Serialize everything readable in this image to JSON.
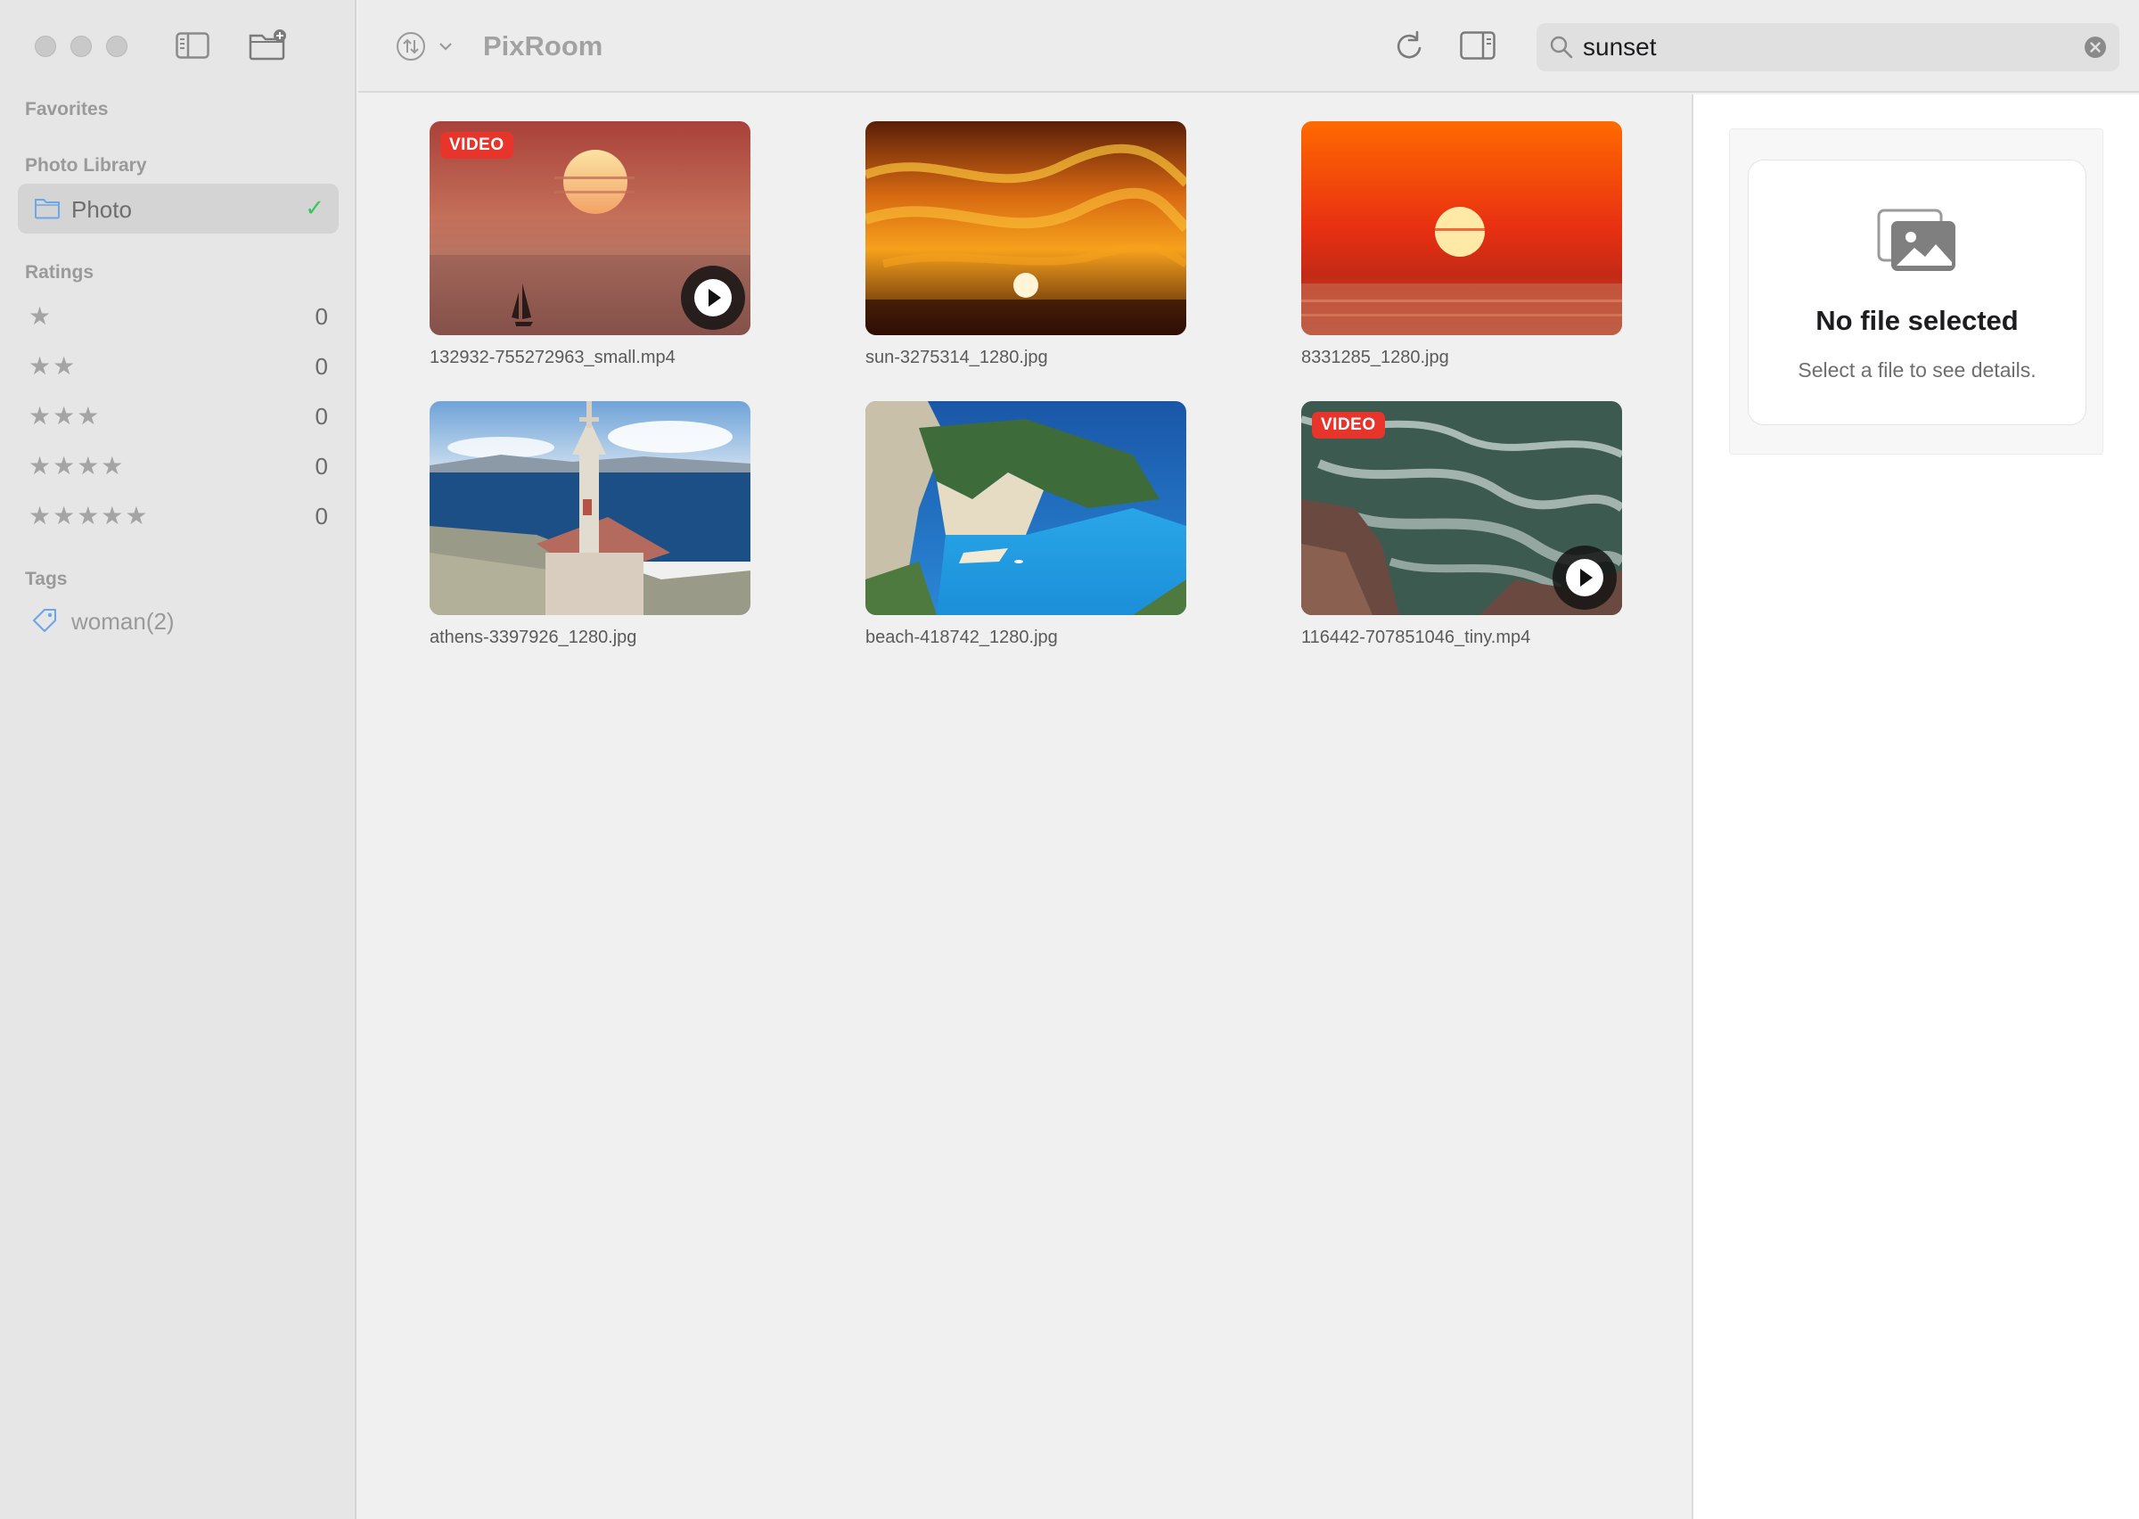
{
  "app": {
    "title": "PixRoom"
  },
  "search": {
    "value": "sunset"
  },
  "sidebar": {
    "favorites_label": "Favorites",
    "library_label": "Photo Library",
    "library_items": [
      {
        "label": "Photo",
        "selected": true
      }
    ],
    "ratings_label": "Ratings",
    "ratings": [
      {
        "stars": "★",
        "count": "0"
      },
      {
        "stars": "★★",
        "count": "0"
      },
      {
        "stars": "★★★",
        "count": "0"
      },
      {
        "stars": "★★★★",
        "count": "0"
      },
      {
        "stars": "★★★★★",
        "count": "0"
      }
    ],
    "tags_label": "Tags",
    "tags": [
      {
        "label": "woman(2)"
      }
    ]
  },
  "grid": {
    "items": [
      {
        "name": "132932-755272963_small.mp4",
        "is_video": true,
        "badge": "VIDEO",
        "scene": "sunset-sailboat"
      },
      {
        "name": "sun-3275314_1280.jpg",
        "is_video": false,
        "scene": "orange-sky-sunset"
      },
      {
        "name": "8331285_1280.jpg",
        "is_video": false,
        "scene": "red-sea-sunset"
      },
      {
        "name": "athens-3397926_1280.jpg",
        "is_video": false,
        "scene": "chapel-coast"
      },
      {
        "name": "beach-418742_1280.jpg",
        "is_video": false,
        "scene": "cove-beach"
      },
      {
        "name": "116442-707851046_tiny.mp4",
        "is_video": true,
        "badge": "VIDEO",
        "scene": "waves-rocks"
      }
    ]
  },
  "details": {
    "title": "No file selected",
    "subtitle": "Select a file to see details."
  },
  "icons": {
    "toggle_sidebar": "sidebar-toggle-icon",
    "new_folder": "folder-plus-icon",
    "sort": "sort-icon",
    "refresh": "refresh-icon",
    "inspector": "inspector-panel-icon",
    "search": "search-icon",
    "clear": "clear-search-icon"
  },
  "colors": {
    "video_badge": "#e7352b",
    "check": "#34c759",
    "folder": "#6aa6e8",
    "tag": "#6aa6e8"
  }
}
